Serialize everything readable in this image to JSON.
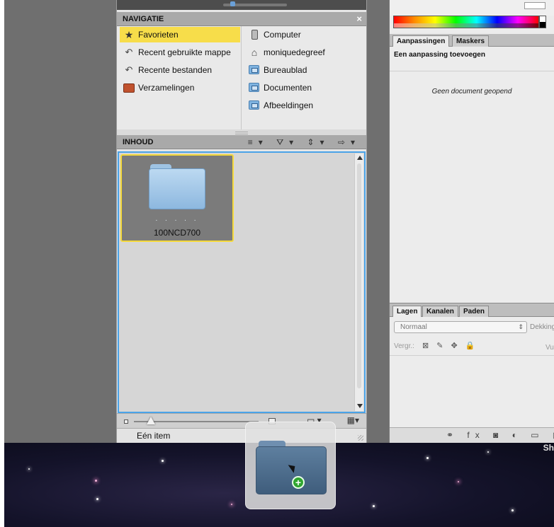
{
  "navigation": {
    "title": "NAVIGATIE",
    "close_label": "×",
    "left_items": [
      {
        "label": "Favorieten",
        "icon": "star-icon",
        "selected": true
      },
      {
        "label": "Recent gebruikte mappe",
        "icon": "recent-folders-icon"
      },
      {
        "label": "Recente bestanden",
        "icon": "recent-files-icon"
      },
      {
        "label": "Verzamelingen",
        "icon": "collections-icon"
      }
    ],
    "right_items": [
      {
        "label": "Computer",
        "icon": "computer-icon"
      },
      {
        "label": "moniquedegreef",
        "icon": "home-icon"
      },
      {
        "label": "Bureaublad",
        "icon": "folder-icon"
      },
      {
        "label": "Documenten",
        "icon": "folder-icon"
      },
      {
        "label": "Afbeeldingen",
        "icon": "folder-icon"
      }
    ]
  },
  "content": {
    "title": "INHOUD",
    "tools": "≡▾ ⛛▾ ⇕▾ ⇨▾",
    "items": [
      {
        "name": "100NCD700",
        "dots": ". . . . ."
      }
    ]
  },
  "bottom_bar": {
    "view_label": "▭ ▾",
    "grid_label": "▦▾"
  },
  "status": {
    "text": "Eén item"
  },
  "right_panel": {
    "tabs": [
      "Aanpassingen",
      "Maskers"
    ],
    "adjustment_title": "Een aanpassing toevoegen",
    "no_document": "Geen document geopend",
    "layer_tabs": [
      "Lagen",
      "Kanalen",
      "Paden"
    ],
    "blend_mode": "Normaal",
    "opacity_label": "Dekking",
    "lock_label": "Vergr.:",
    "lock_icons": "⊠ ✎ ✥ 🔒",
    "fill_label": "Vu",
    "footer_icons": "⚭ fx ◙ ◐ ▭ ▢"
  },
  "desktop": {
    "label": "Sh"
  },
  "drag": {
    "plus": "+"
  },
  "colors": {
    "selected_highlight": "#f7dd4a",
    "content_border": "#4aa3e8",
    "thumb_border": "#f5d93a",
    "header_bg": "#a9a9a9",
    "copy_badge": "#2fa52f"
  }
}
